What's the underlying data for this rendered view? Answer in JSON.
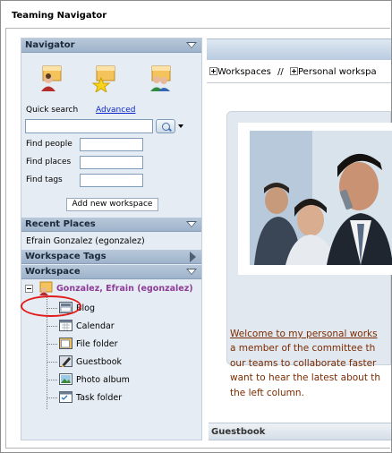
{
  "window": {
    "title": "Teaming Navigator"
  },
  "navigator": {
    "header": "Navigator",
    "quick_search_label": "Quick search",
    "advanced_link": "Advanced",
    "quick_search_value": "",
    "find_people_label": "Find people",
    "find_places_label": "Find places",
    "find_tags_label": "Find tags",
    "add_workspace_button": "Add new workspace"
  },
  "recent_places": {
    "header": "Recent Places",
    "items": [
      "Efrain Gonzalez (egonzalez)"
    ]
  },
  "workspace_tags": {
    "header": "Workspace Tags"
  },
  "workspace": {
    "header": "Workspace",
    "root": "Gonzalez, Efrain (egonzalez)",
    "items": [
      {
        "label": "Blog",
        "icon": "blog-icon"
      },
      {
        "label": "Calendar",
        "icon": "calendar-icon"
      },
      {
        "label": "File folder",
        "icon": "file-folder-icon"
      },
      {
        "label": "Guestbook",
        "icon": "guestbook-icon"
      },
      {
        "label": "Photo album",
        "icon": "photo-album-icon"
      },
      {
        "label": "Task folder",
        "icon": "task-folder-icon"
      }
    ]
  },
  "content": {
    "breadcrumb_workspaces": "Workspaces",
    "breadcrumb_sep": "//",
    "breadcrumb_personal": "Personal workspa",
    "welcome_link": "Welcome to my personal works",
    "welcome_lines": [
      "a member of the committee th",
      "our teams to collaborate faster",
      "want to hear the latest about th",
      "the left column."
    ],
    "guestbook_header": "Guestbook"
  },
  "colors": {
    "header_bg": "#a9bcd2",
    "root_text": "#8c3c96",
    "link": "#0a27c9",
    "welcome_text": "#7a2b00",
    "highlight": "#e21b1b"
  }
}
